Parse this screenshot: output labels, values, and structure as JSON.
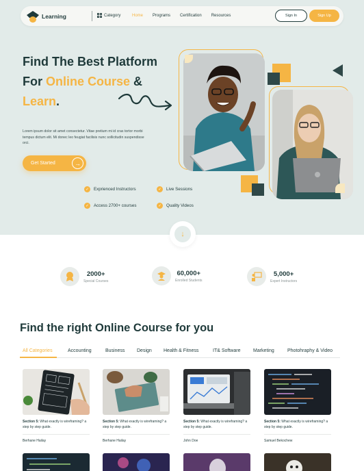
{
  "nav": {
    "logo_text": "Learning",
    "category_label": "Category",
    "links": [
      "Home",
      "Programs",
      "Certification",
      "Resources"
    ],
    "signin_label": "Sign In",
    "signup_label": "Sign Up"
  },
  "hero": {
    "title_line1": "Find The Best Platform",
    "title_for": "For ",
    "title_hl1": "Online Course",
    "title_amp": " &",
    "title_hl2": "Learn",
    "title_dot": ".",
    "description": "Lorem ipsum dolor sit amet consectetur. Vitae pretium mi id cras tortor morbi tempus dictum elit. Mi donec leo feugiat facilisis nunc sollicitudin suspendisse orci.",
    "cta_label": "Get Started",
    "features": [
      "Exprienced Instructors",
      "Live Sessions",
      "Access 2700+ courses",
      "Quality Videos"
    ]
  },
  "stats": [
    {
      "number": "2000+",
      "label": "Special Courses"
    },
    {
      "number": "60,000+",
      "label": "Enrolled Students"
    },
    {
      "number": "5,000+",
      "label": "Expert Instructors"
    }
  ],
  "courses": {
    "title": "Find the right Online Course for you",
    "tabs": [
      "All Categories",
      "Accounting",
      "Business",
      "Design",
      "Health & Fitness",
      "IT& Software",
      "Marketing",
      "Photohraphy & Video"
    ],
    "cards": [
      {
        "section": "Section 5:",
        "title": " What exactly is wireframing? a step by step guide.",
        "author": "Berhane Hailay"
      },
      {
        "section": "Section 5:",
        "title": " What exactly is wireframing? a step by step guide.",
        "author": "Berhane Hailay"
      },
      {
        "section": "Section 5:",
        "title": " What exactly is wireframing? a step by step guide.",
        "author": "John Doe"
      },
      {
        "section": "Section 5:",
        "title": " What exactly is wireframing? a step by step guide.",
        "author": "Samuel Bekochew"
      }
    ]
  },
  "colors": {
    "accent": "#f5b544",
    "dark": "#1f3a3a",
    "hero_bg": "#e2ebe9"
  }
}
